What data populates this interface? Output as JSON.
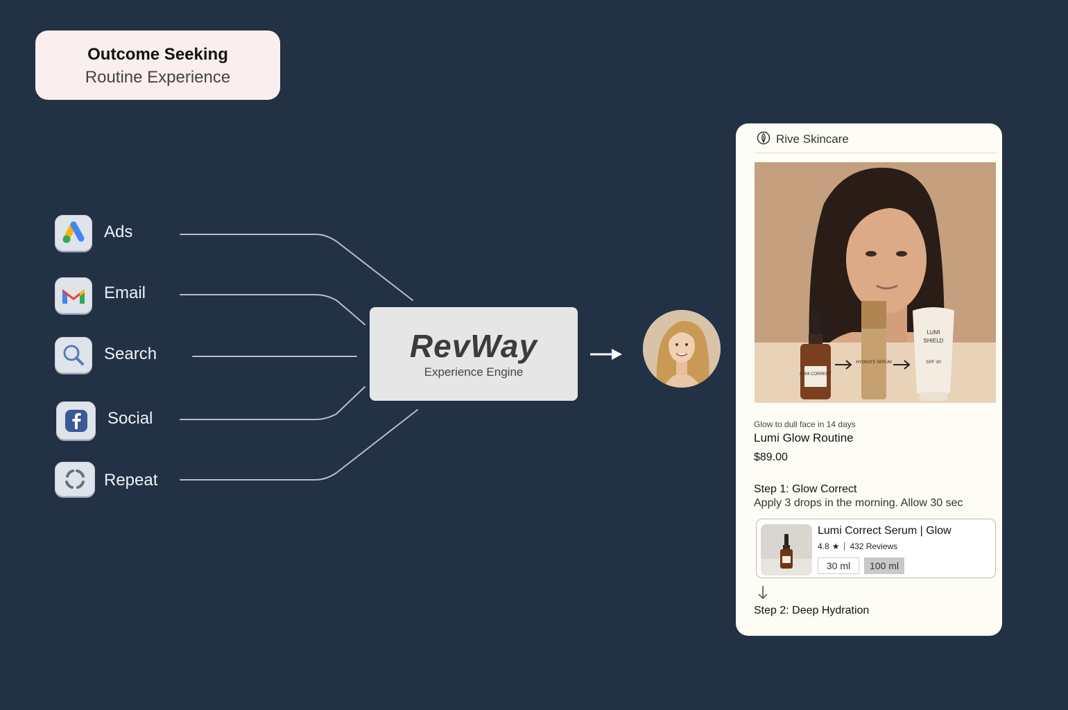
{
  "header": {
    "title": "Outcome Seeking",
    "subtitle": "Routine Experience"
  },
  "channels": [
    {
      "label": "Ads",
      "icon": "google-ads-icon"
    },
    {
      "label": "Email",
      "icon": "gmail-icon"
    },
    {
      "label": "Search",
      "icon": "search-icon"
    },
    {
      "label": "Social",
      "icon": "facebook-icon"
    },
    {
      "label": "Repeat",
      "icon": "repeat-icon"
    }
  ],
  "engine": {
    "logo": "RevWay",
    "subtitle": "Experience Engine"
  },
  "phone": {
    "brand": "Rive Skincare",
    "hero_labels": {
      "bottle1": "LUMI CORRECT",
      "bottle2": "HYDRATE SERUM",
      "bottle3_line1": "LUMI",
      "bottle3_line2": "SHIELD",
      "bottle3_line3": "SPF 30"
    },
    "tagline": "Glow to dull face in 14 days",
    "product_title": "Lumi Glow Routine",
    "price": "$89.00",
    "step1_title": "Step 1:  Glow Correct",
    "step1_desc": "Apply 3 drops in the morning. Allow 30 sec",
    "product_card": {
      "name": "Lumi Correct Serum | Glow",
      "rating": "4.8",
      "reviews": "432 Reviews",
      "sizes": [
        "30 ml",
        "100 ml"
      ],
      "selected_size": "100 ml"
    },
    "step2_title": "Step 2:  Deep Hydration"
  },
  "colors": {
    "background": "#233145",
    "title_card": "#faeeee",
    "engine_box": "#e6e6e6",
    "phone_card": "#fdfcf5"
  }
}
